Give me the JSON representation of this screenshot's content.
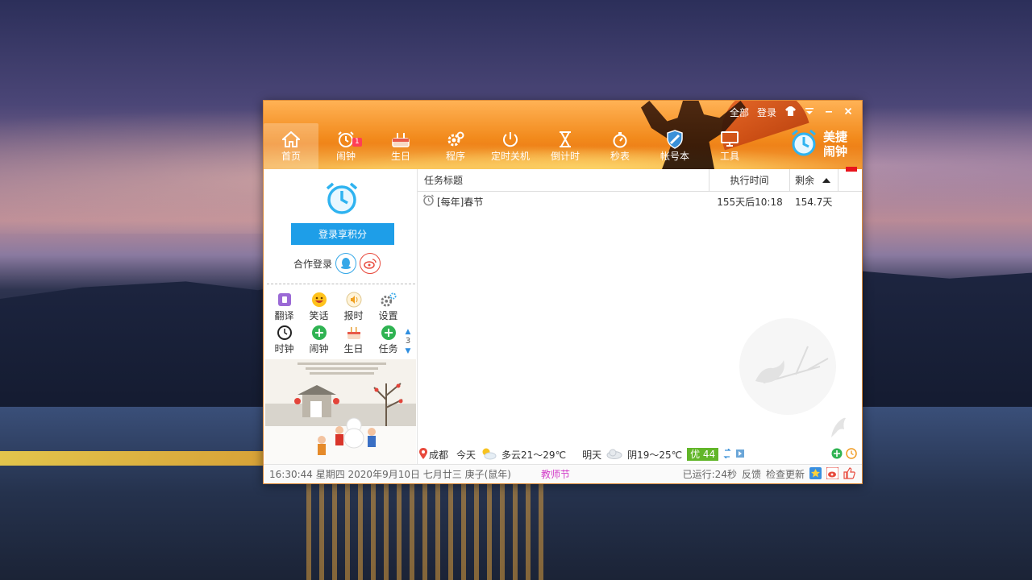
{
  "window": {
    "top_links": {
      "all": "全部",
      "login": "登录"
    },
    "nav": [
      {
        "label": "首页",
        "icon": "home-icon"
      },
      {
        "label": "闹钟",
        "icon": "alarm-icon",
        "badge": "1"
      },
      {
        "label": "生日",
        "icon": "cake-icon"
      },
      {
        "label": "程序",
        "icon": "gear-icon"
      },
      {
        "label": "定时关机",
        "icon": "power-icon"
      },
      {
        "label": "倒计时",
        "icon": "hourglass-icon"
      },
      {
        "label": "秒表",
        "icon": "stopwatch-icon"
      },
      {
        "label": "帐号本",
        "icon": "shield-icon"
      },
      {
        "label": "工具",
        "icon": "monitor-icon"
      }
    ],
    "brand": "美捷闹钟",
    "active_nav": "首页"
  },
  "left": {
    "login_button": "登录享积分",
    "coop_login": "合作登录",
    "tools": [
      {
        "label": "翻译",
        "icon": "translate-icon"
      },
      {
        "label": "笑话",
        "icon": "smile-icon"
      },
      {
        "label": "报时",
        "icon": "speaker-icon"
      },
      {
        "label": "设置",
        "icon": "settings-icon"
      },
      {
        "label": "时钟",
        "icon": "clock-icon"
      },
      {
        "label": "闹钟",
        "icon": "plus-icon"
      },
      {
        "label": "生日",
        "icon": "cake-icon"
      },
      {
        "label": "任务",
        "icon": "plus-icon"
      }
    ],
    "page": "3"
  },
  "table": {
    "headers": {
      "title": "任务标题",
      "time": "执行时间",
      "remaining": "剩余"
    },
    "rows": [
      {
        "title": "[每年]春节",
        "time": "155天后10:18",
        "remaining": "154.7天"
      }
    ]
  },
  "weather": {
    "city": "成都",
    "today_label": "今天",
    "today": "多云21～29℃",
    "tomorrow_label": "明天",
    "tomorrow": "阴19～25℃",
    "aqi": "优 44"
  },
  "status": {
    "datetime": "16:30:44 星期四 2020年9月10日 七月廿三 庚子(鼠年)",
    "holiday": "教师节",
    "running": "已运行:24秒",
    "feedback": "反馈",
    "update": "检查更新"
  },
  "colors": {
    "accent": "#1e9ee8",
    "header": "#f28a1c",
    "holiday": "#d23ac8",
    "aqi": "#62b629"
  }
}
